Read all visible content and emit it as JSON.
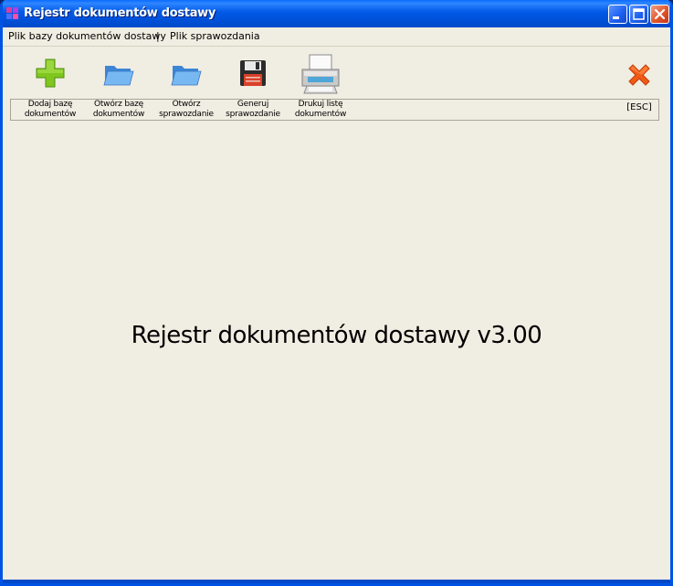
{
  "window": {
    "title": "Rejestr dokumentów dostawy",
    "controls": {
      "minimize": "minimize-icon",
      "maximize": "maximize-icon",
      "close": "close-icon"
    }
  },
  "menu": {
    "items": [
      {
        "label": "Plik bazy dokumentów dostawy"
      },
      {
        "label": "Plik sprawozdania"
      }
    ],
    "separator": "|"
  },
  "toolbar": {
    "buttons": [
      {
        "label_line1": "Dodaj bazę",
        "label_line2": "dokumentów",
        "icon": "green-plus-icon"
      },
      {
        "label_line1": "Otwórz bazę",
        "label_line2": "dokumentów",
        "icon": "folder-open-icon"
      },
      {
        "label_line1": "Otwórz",
        "label_line2": "sprawozdanie",
        "icon": "folder-open-icon"
      },
      {
        "label_line1": "Generuj",
        "label_line2": "sprawozdanie",
        "icon": "floppy-disk-icon"
      },
      {
        "label_line1": "Drukuj listę",
        "label_line2": "dokumentów",
        "icon": "printer-icon"
      }
    ],
    "exit": {
      "label": "[ESC]",
      "icon": "red-x-icon"
    }
  },
  "main": {
    "heading": "Rejestr dokumentów dostawy v3.00"
  },
  "colors": {
    "titlebar": "#0058e6",
    "window_bg": "#f0ede2",
    "close_button": "#e2562b"
  }
}
